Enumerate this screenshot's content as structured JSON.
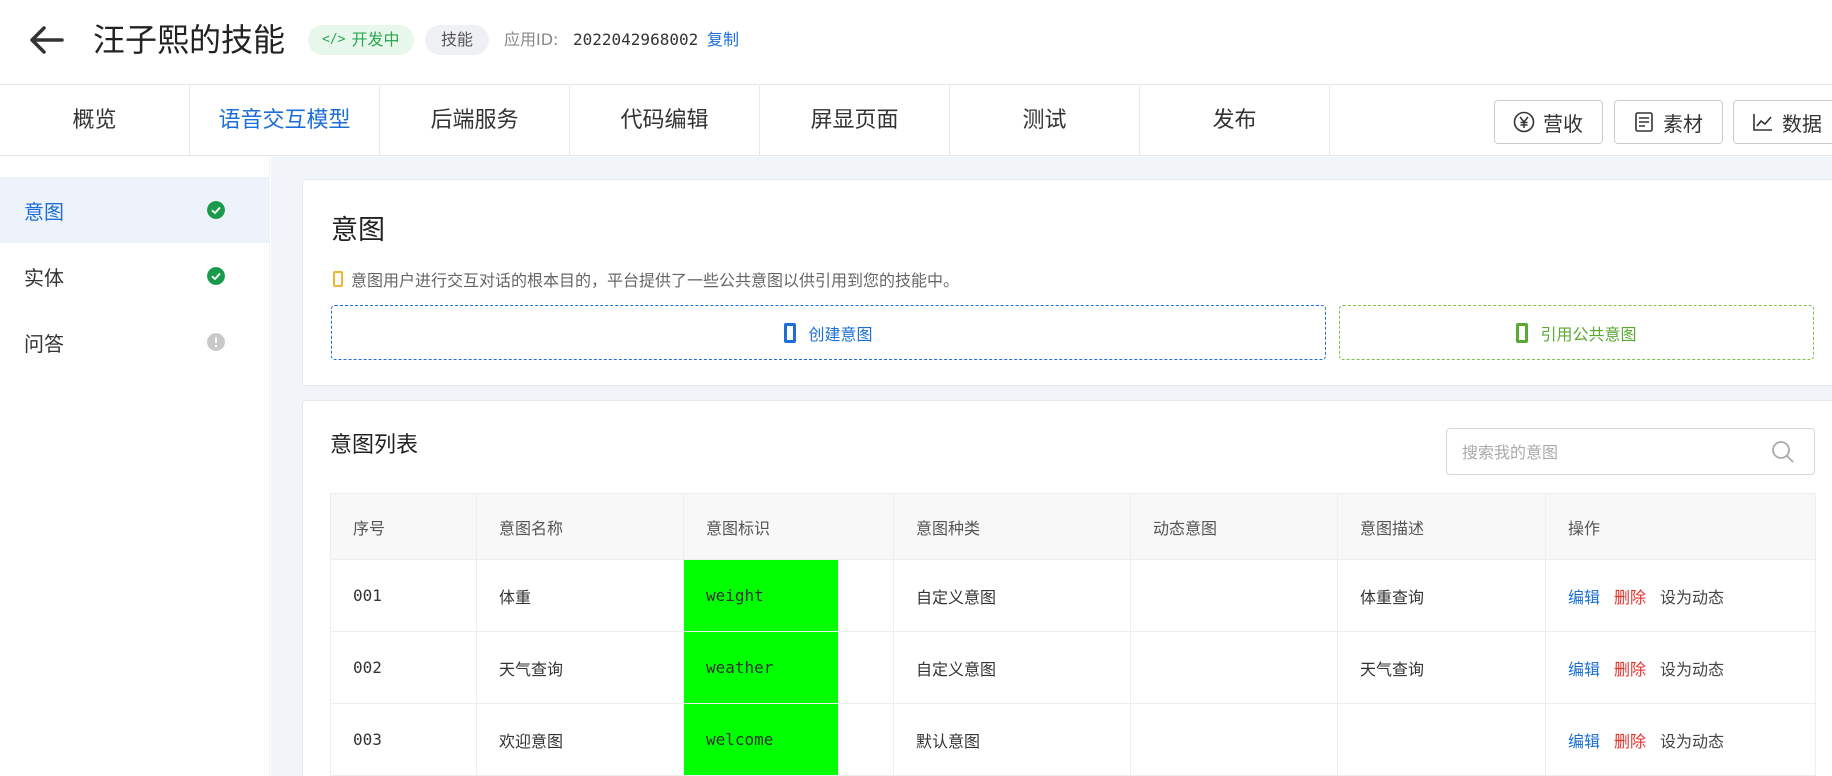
{
  "header": {
    "title": "汪子熙的技能",
    "status_badge": "开发中",
    "status_badge_icon": "code-icon",
    "type_badge": "技能",
    "app_id_label": "应用ID:",
    "app_id_value": "2022042968002",
    "copy_label": "复制"
  },
  "tabs": [
    {
      "label": "概览"
    },
    {
      "label": "语音交互模型",
      "active": true
    },
    {
      "label": "后端服务"
    },
    {
      "label": "代码编辑"
    },
    {
      "label": "屏显页面"
    },
    {
      "label": "测试"
    },
    {
      "label": "发布"
    }
  ],
  "toolbar": {
    "revenue_label": "营收",
    "revenue_icon": "yen-icon",
    "material_label": "素材",
    "material_icon": "document-icon",
    "data_label": "数据",
    "data_icon": "chart-icon"
  },
  "sidebar": {
    "items": [
      {
        "label": "意图",
        "status": "complete",
        "active": true
      },
      {
        "label": "实体",
        "status": "complete"
      },
      {
        "label": "问答",
        "status": "incomplete"
      }
    ]
  },
  "intent_card": {
    "title": "意图",
    "description": "意图用户进行交互对话的根本目的，平台提供了一些公共意图以供引用到您的技能中。",
    "create_label": "创建意图",
    "reference_label": "引用公共意图"
  },
  "list": {
    "title": "意图列表",
    "search_placeholder": "搜索我的意图",
    "columns": [
      "序号",
      "意图名称",
      "意图标识",
      "意图种类",
      "动态意图",
      "意图描述",
      "操作"
    ],
    "rows": [
      {
        "no": "001",
        "name": "体重",
        "id": "weight",
        "kind": "自定义意图",
        "dynamic": "",
        "desc": "体重查询"
      },
      {
        "no": "002",
        "name": "天气查询",
        "id": "weather",
        "kind": "自定义意图",
        "dynamic": "",
        "desc": "天气查询"
      },
      {
        "no": "003",
        "name": "欢迎意图",
        "id": "welcome",
        "kind": "默认意图",
        "dynamic": "",
        "desc": ""
      }
    ],
    "actions": {
      "edit": "编辑",
      "delete": "删除",
      "set_dynamic": "设为动态"
    }
  },
  "colors": {
    "primary": "#1b6fd6",
    "success": "#1a9b4b",
    "danger": "#e0312b",
    "highlight": "#00ff00",
    "accent_green": "#5aa933"
  }
}
